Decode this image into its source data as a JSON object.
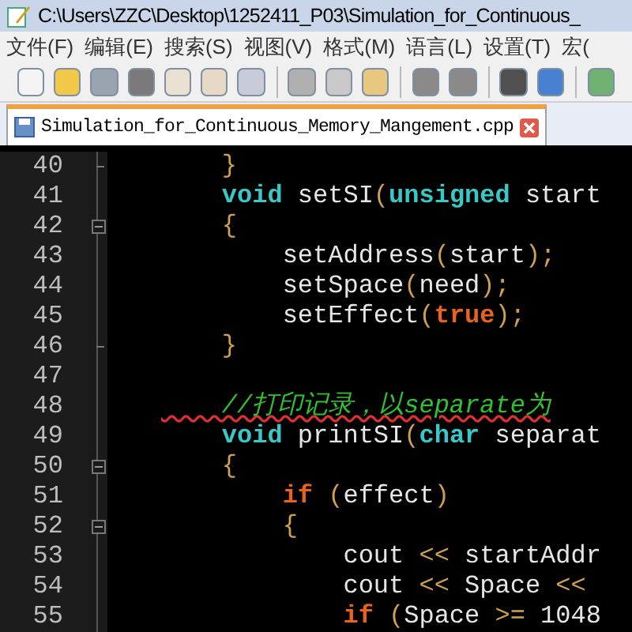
{
  "window": {
    "title": "C:\\Users\\ZZC\\Desktop\\1252411_P03\\Simulation_for_Continuous_"
  },
  "menu": [
    "文件(F)",
    "编辑(E)",
    "搜索(S)",
    "视图(V)",
    "格式(M)",
    "语言(L)",
    "设置(T)",
    "宏("
  ],
  "tabs": [
    {
      "label": "Simulation_for_Continuous_Memory_Mangement.cpp",
      "selected": true
    }
  ],
  "editor": {
    "lines": [
      {
        "number": "40",
        "fold_start": false,
        "fold_end": true,
        "tokens": [
          {
            "kind": "punct",
            "text": "    }"
          }
        ]
      },
      {
        "number": "41",
        "fold_start": false,
        "fold_end": false,
        "tokens": [
          {
            "kind": "keyword",
            "text": "    void"
          },
          {
            "kind": "plain",
            "text": " setSI"
          },
          {
            "kind": "punct",
            "text": "("
          },
          {
            "kind": "keyword",
            "text": "unsigned"
          },
          {
            "kind": "plain",
            "text": " start"
          }
        ]
      },
      {
        "number": "42",
        "fold_start": true,
        "fold_end": false,
        "tokens": [
          {
            "kind": "punct",
            "text": "    {"
          }
        ]
      },
      {
        "number": "43",
        "fold_start": false,
        "fold_end": false,
        "tokens": [
          {
            "kind": "plain",
            "text": "        setAddress"
          },
          {
            "kind": "punct",
            "text": "("
          },
          {
            "kind": "plain",
            "text": "start"
          },
          {
            "kind": "punct",
            "text": ");"
          }
        ]
      },
      {
        "number": "44",
        "fold_start": false,
        "fold_end": false,
        "tokens": [
          {
            "kind": "plain",
            "text": "        setSpace"
          },
          {
            "kind": "punct",
            "text": "("
          },
          {
            "kind": "plain",
            "text": "need"
          },
          {
            "kind": "punct",
            "text": ");"
          }
        ]
      },
      {
        "number": "45",
        "fold_start": false,
        "fold_end": false,
        "tokens": [
          {
            "kind": "plain",
            "text": "        setEffect"
          },
          {
            "kind": "punct",
            "text": "("
          },
          {
            "kind": "control",
            "text": "true"
          },
          {
            "kind": "punct",
            "text": ");"
          }
        ]
      },
      {
        "number": "46",
        "fold_start": false,
        "fold_end": true,
        "tokens": [
          {
            "kind": "punct",
            "text": "    }"
          }
        ]
      },
      {
        "number": "47",
        "fold_start": false,
        "fold_end": false
      },
      {
        "number": "48",
        "fold_start": false,
        "fold_end": false,
        "tokens": [
          {
            "kind": "comment",
            "text": "    //打印记录，以separate为"
          }
        ]
      },
      {
        "number": "49",
        "fold_start": false,
        "fold_end": false,
        "tokens": [
          {
            "kind": "keyword",
            "text": "    void"
          },
          {
            "kind": "plain",
            "text": " printSI"
          },
          {
            "kind": "punct",
            "text": "("
          },
          {
            "kind": "keyword",
            "text": "char"
          },
          {
            "kind": "plain",
            "text": " separat"
          }
        ]
      },
      {
        "number": "50",
        "fold_start": true,
        "fold_end": false,
        "tokens": [
          {
            "kind": "punct",
            "text": "    {"
          }
        ]
      },
      {
        "number": "51",
        "fold_start": false,
        "fold_end": false,
        "tokens": [
          {
            "kind": "control",
            "text": "        if"
          },
          {
            "kind": "punct",
            "text": " ("
          },
          {
            "kind": "plain",
            "text": "effect"
          },
          {
            "kind": "punct",
            "text": ")"
          }
        ]
      },
      {
        "number": "52",
        "fold_start": true,
        "fold_end": false,
        "tokens": [
          {
            "kind": "punct",
            "text": "        {"
          }
        ]
      },
      {
        "number": "53",
        "fold_start": false,
        "fold_end": false,
        "tokens": [
          {
            "kind": "plain",
            "text": "            cout"
          },
          {
            "kind": "punct",
            "text": " <<"
          },
          {
            "kind": "plain",
            "text": " startAddr"
          }
        ]
      },
      {
        "number": "54",
        "fold_start": false,
        "fold_end": false,
        "tokens": [
          {
            "kind": "plain",
            "text": "            cout"
          },
          {
            "kind": "punct",
            "text": " <<"
          },
          {
            "kind": "plain",
            "text": " Space"
          },
          {
            "kind": "punct",
            "text": " <<"
          }
        ]
      },
      {
        "number": "55",
        "fold_start": false,
        "fold_end": false,
        "tokens": [
          {
            "kind": "control",
            "text": "            if"
          },
          {
            "kind": "punct",
            "text": " ("
          },
          {
            "kind": "plain",
            "text": "Space"
          },
          {
            "kind": "punct",
            "text": " >="
          },
          {
            "kind": "plain",
            "text": " 1048"
          }
        ]
      }
    ]
  }
}
